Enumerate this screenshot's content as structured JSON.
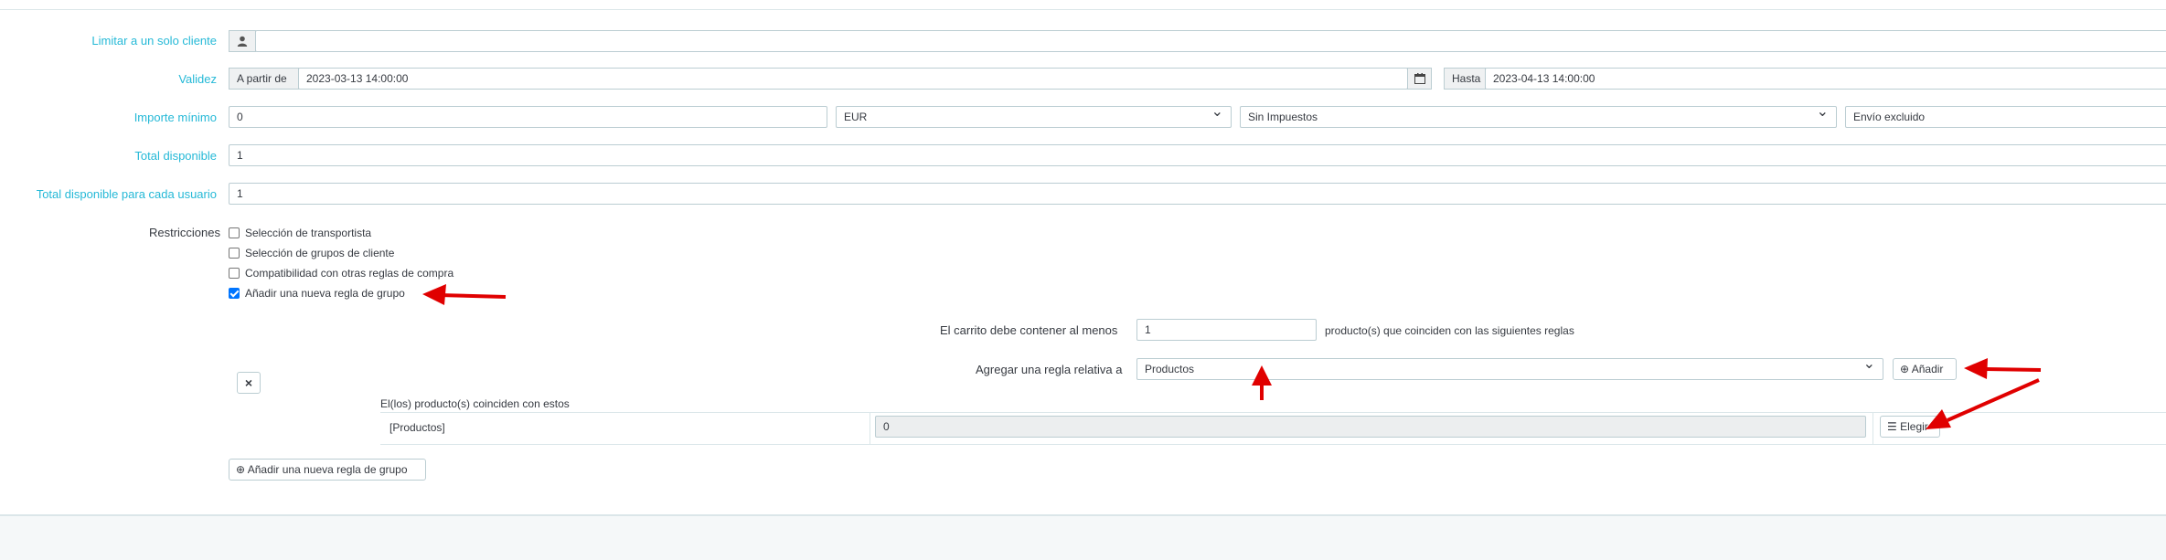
{
  "fields": {
    "limit_customer_label": "Limitar a un solo cliente",
    "validity_label": "Validez",
    "from_addon": "A partir de",
    "from_value": "2023-03-13 14:00:00",
    "to_addon": "Hasta",
    "to_value": "2023-04-13 14:00:00",
    "min_amount_label": "Importe mínimo",
    "min_amount_value": "0",
    "currency_value": "EUR",
    "tax_value": "Sin Impuestos",
    "shipping_value": "Envío excluido",
    "total_available_label": "Total disponible",
    "total_available_value": "1",
    "total_per_user_label": "Total disponible para cada usuario",
    "total_per_user_value": "1"
  },
  "restrictions": {
    "label": "Restricciones",
    "options": [
      {
        "label": "Selección de transportista",
        "checked": false
      },
      {
        "label": "Selección de grupos de cliente",
        "checked": false
      },
      {
        "label": "Compatibilidad con otras reglas de compra",
        "checked": false
      },
      {
        "label": "Añadir una nueva regla de grupo",
        "checked": true
      }
    ]
  },
  "rule_group": {
    "cart_must_contain_label": "El carrito debe contener al menos",
    "quantity_value": "1",
    "matching_suffix": "producto(s) que coinciden con las siguientes reglas",
    "add_rule_label": "Agregar una regla relativa a",
    "rule_type_value": "Productos",
    "add_button": "Añadir",
    "remove_icon": "×",
    "products_match_label": "El(los) producto(s) coinciden con estos",
    "rule_row_name": "[Productos]",
    "rule_row_value": "0",
    "choose_button": "Elegir",
    "add_group_button": "Añadir una nueva regla de grupo"
  },
  "colors": {
    "label": "#25b9d7",
    "arrow": "#e00000",
    "border": "#bbcdd2"
  }
}
